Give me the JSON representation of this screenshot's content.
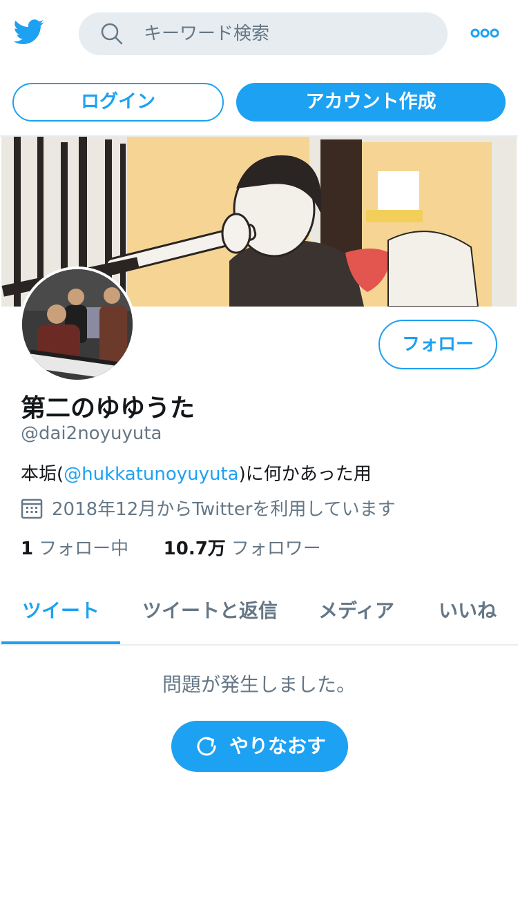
{
  "header": {
    "logo_icon": "twitter-bird-icon",
    "search": {
      "placeholder": "キーワード検索",
      "icon": "search-icon"
    },
    "more_icon": "more-dots-icon"
  },
  "auth": {
    "login_label": "ログイン",
    "signup_label": "アカウント作成"
  },
  "profile": {
    "follow_label": "フォロー",
    "name": "第二のゆゆうた",
    "handle": "@dai2noyuyuta",
    "bio_prefix": "本垢(",
    "bio_mention": "@hukkatunoyuyuta",
    "bio_suffix": ")に何かあった用",
    "joined": "2018年12月からTwitterを利用しています",
    "following_count": "1",
    "following_label": "フォロー中",
    "followers_count": "10.7万",
    "followers_label": "フォロワー"
  },
  "tabs": [
    {
      "label": "ツイート",
      "active": true
    },
    {
      "label": "ツイートと返信",
      "active": false
    },
    {
      "label": "メディア",
      "active": false
    },
    {
      "label": "いいね",
      "active": false
    }
  ],
  "timeline": {
    "error_message": "問題が発生しました。",
    "retry_label": "やりなおす"
  },
  "colors": {
    "accent": "#1da1f2",
    "secondary_text": "#657786",
    "primary_text": "#14171a",
    "search_bg": "#e6ecf0"
  }
}
